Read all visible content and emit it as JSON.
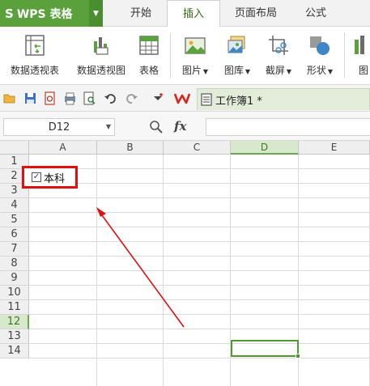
{
  "app": {
    "logo": "S",
    "name": "WPS 表格",
    "menu_arrow": "▼"
  },
  "tabs": [
    {
      "label": "开始",
      "active": false
    },
    {
      "label": "插入",
      "active": true
    },
    {
      "label": "页面布局",
      "active": false
    },
    {
      "label": "公式",
      "active": false
    }
  ],
  "ribbon": {
    "items": [
      {
        "label": "数据透视表",
        "icon": "pivot-table-icon",
        "dropdown": false
      },
      {
        "label": "数据透视图",
        "icon": "pivot-chart-icon",
        "dropdown": false
      },
      {
        "label": "表格",
        "icon": "table-icon",
        "dropdown": false
      },
      {
        "label": "图片",
        "icon": "picture-icon",
        "dropdown": true
      },
      {
        "label": "图库",
        "icon": "gallery-icon",
        "dropdown": true
      },
      {
        "label": "截屏",
        "icon": "screenshot-icon",
        "dropdown": true
      },
      {
        "label": "形状",
        "icon": "shapes-icon",
        "dropdown": true
      },
      {
        "label": "图",
        "icon": "chart-icon",
        "dropdown": false
      }
    ],
    "dropdown_glyph": "▼"
  },
  "quick_access": {
    "icons": [
      "open-folder-icon",
      "save-icon",
      "export-pdf-icon",
      "print-icon",
      "print-preview-icon",
      "undo-icon",
      "redo-icon",
      "customize-icon",
      "wps-icon"
    ],
    "doc_tab": "工作簿1 *"
  },
  "formula_bar": {
    "name_box": "D12",
    "fx": "fx",
    "value": ""
  },
  "sheet": {
    "columns": [
      "A",
      "B",
      "C",
      "D",
      "E"
    ],
    "selected_column": "D",
    "rows": [
      "1",
      "2",
      "3",
      "4",
      "5",
      "6",
      "7",
      "8",
      "9",
      "10",
      "11",
      "12",
      "13",
      "14"
    ],
    "selected_row": "12",
    "checkbox": {
      "label": "本科",
      "checked": true,
      "check_glyph": "✓"
    }
  },
  "colors": {
    "accent": "#5aa03b",
    "highlight_box": "#e01010",
    "arrow": "#e01010",
    "selection": "#4e9a2c"
  }
}
